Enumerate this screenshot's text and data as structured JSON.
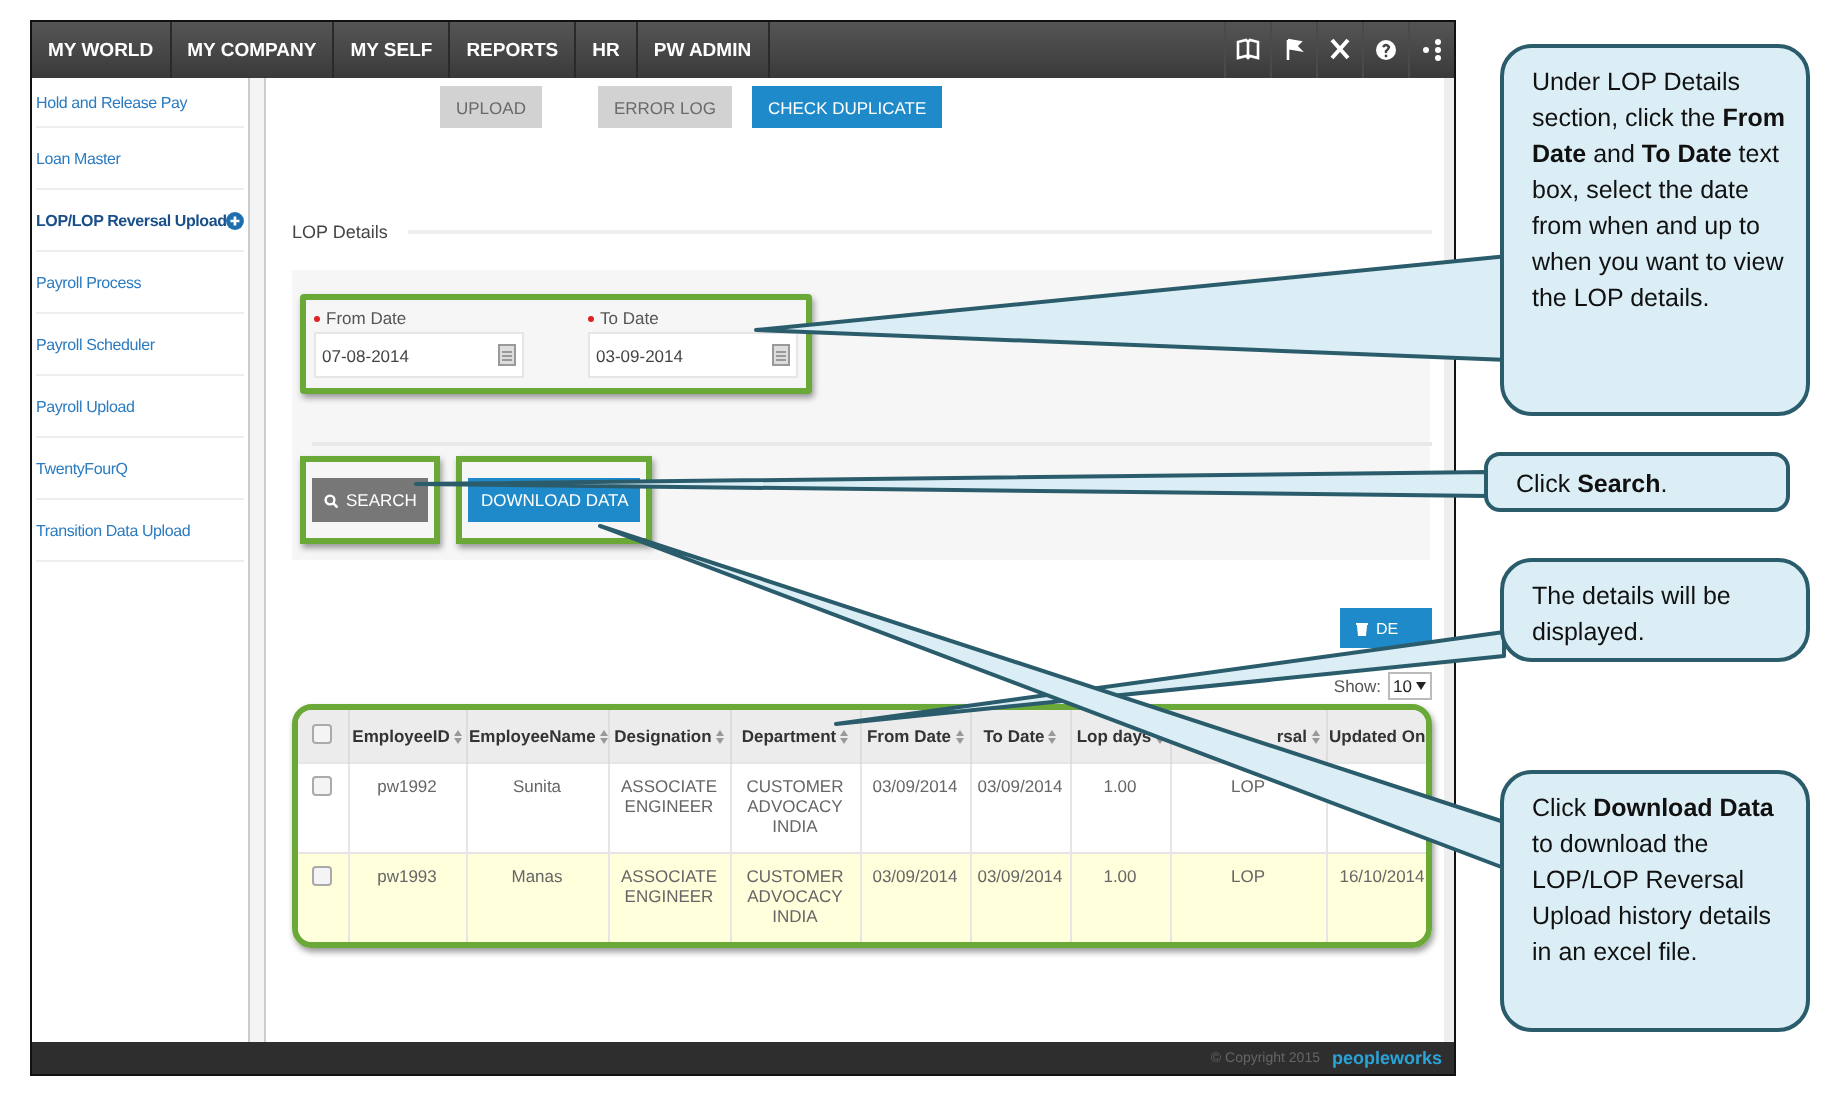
{
  "nav": {
    "items": [
      {
        "label": "MY WORLD"
      },
      {
        "label": "MY COMPANY"
      },
      {
        "label": "MY SELF"
      },
      {
        "label": "REPORTS"
      },
      {
        "label": "HR"
      },
      {
        "label": "PW ADMIN"
      }
    ]
  },
  "sidebar": {
    "items": [
      {
        "label": "Hold and Release Pay",
        "selected": false
      },
      {
        "label": "Loan Master",
        "selected": false
      },
      {
        "label": "LOP/LOP Reversal Upload",
        "selected": true
      },
      {
        "label": "Payroll Process",
        "selected": false
      },
      {
        "label": "Payroll Scheduler",
        "selected": false
      },
      {
        "label": "Payroll Upload",
        "selected": false
      },
      {
        "label": "TwentyFourQ",
        "selected": false
      },
      {
        "label": "Transition Data Upload",
        "selected": false
      }
    ]
  },
  "toolbar": {
    "buttons": [
      {
        "label": "UPLOAD",
        "disabled": true
      },
      {
        "label": "ERROR LOG",
        "disabled": true
      },
      {
        "label": "CHECK DUPLICATE",
        "disabled": false
      }
    ]
  },
  "section_title": "LOP Details",
  "filters": {
    "fields": [
      {
        "label": "From Date",
        "required": true,
        "value": "07-08-2014"
      },
      {
        "label": "To Date",
        "required": true,
        "value": "03-09-2014"
      }
    ],
    "search_button": "SEARCH",
    "download_button": "DOWNLOAD DATA"
  },
  "delete_button": "DE",
  "show": {
    "label": "Show:",
    "value": "10"
  },
  "table": {
    "all_checked": false,
    "columns": [
      "EmployeeID",
      "EmployeeName",
      "Designation",
      "Department",
      "From Date",
      "To Date",
      "Lop days",
      "rsal",
      "Updated On"
    ],
    "rows": [
      {
        "checked": false,
        "highlighted": false,
        "cells": [
          "pw1992",
          "Sunita",
          "ASSOCIATE ENGINEER",
          "CUSTOMER ADVOCACY INDIA",
          "03/09/2014",
          "03/09/2014",
          "1.00",
          "LOP"
        ]
      },
      {
        "checked": false,
        "highlighted": true,
        "cells": [
          "pw1993",
          "Manas",
          "ASSOCIATE ENGINEER",
          "CUSTOMER ADVOCACY INDIA",
          "03/09/2014",
          "03/09/2014",
          "1.00",
          "LOP",
          "16/10/2014"
        ]
      }
    ]
  },
  "footer": {
    "copyright": "© Copyright 2015",
    "logo": "peopleworks"
  },
  "callouts": [
    {
      "text": "Under LOP Details section, click the **From Date** and **To Date** text box, select the date from when and up to when you want to view the LOP details."
    },
    {
      "text": "Click **Search**."
    },
    {
      "text": "The details will be displayed."
    },
    {
      "text": "Click **Download Data** to download the LOP/LOP Reversal Upload history details in an excel file."
    }
  ]
}
